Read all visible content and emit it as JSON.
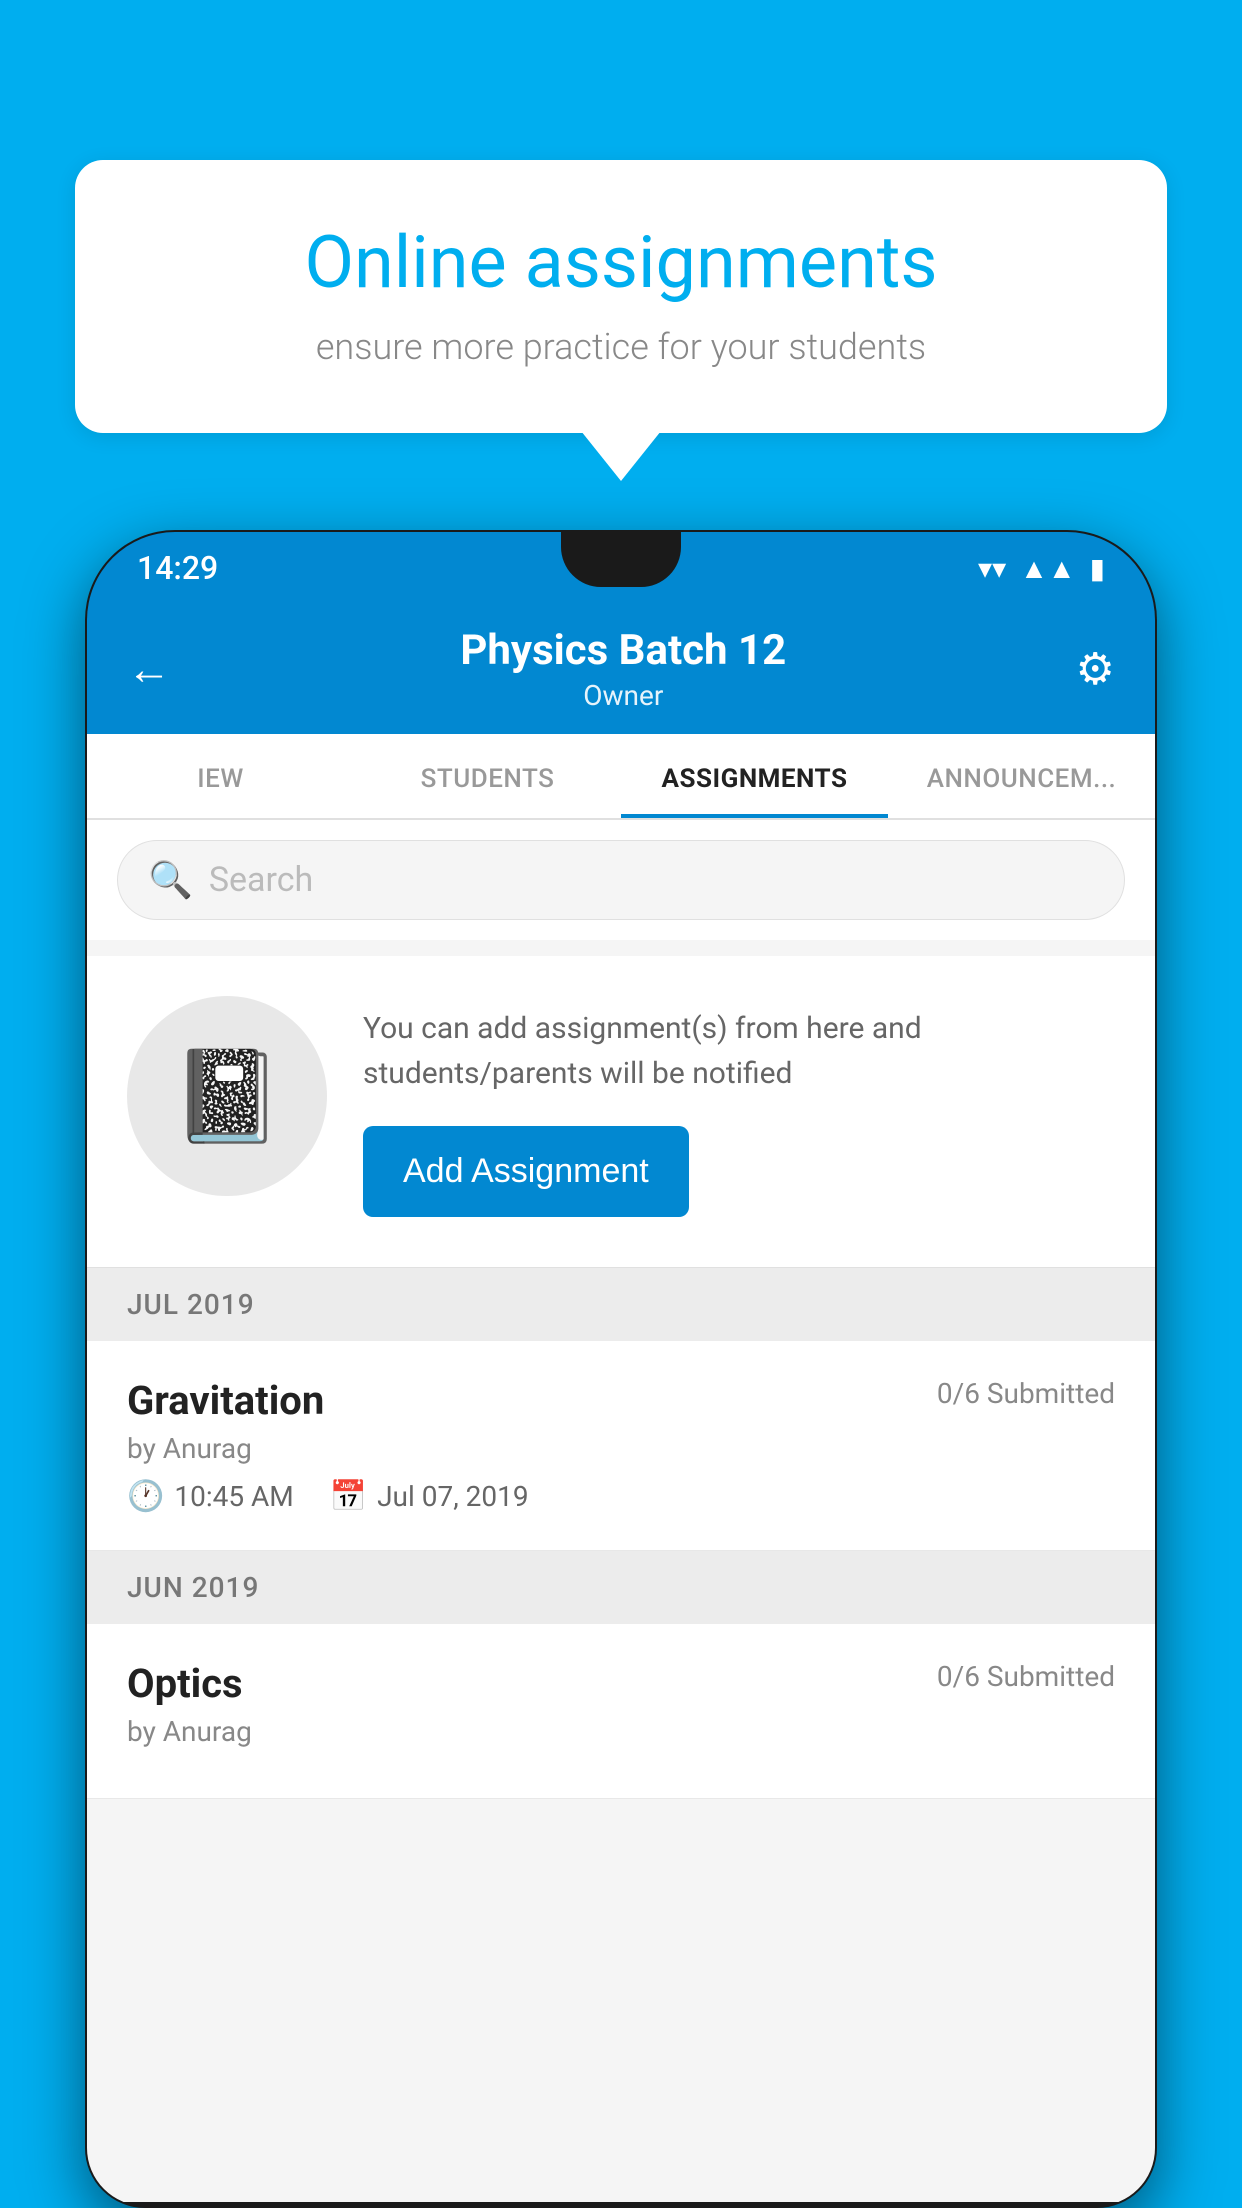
{
  "background_color": "#00AEEF",
  "bubble": {
    "title": "Online assignments",
    "subtitle": "ensure more practice for your students"
  },
  "status_bar": {
    "time": "14:29",
    "wifi_icon": "▼",
    "signal_icon": "◀",
    "battery_icon": "▮"
  },
  "header": {
    "title": "Physics Batch 12",
    "subtitle": "Owner",
    "back_icon": "←",
    "settings_icon": "⚙"
  },
  "tabs": [
    {
      "label": "IEW",
      "active": false
    },
    {
      "label": "STUDENTS",
      "active": false
    },
    {
      "label": "ASSIGNMENTS",
      "active": true
    },
    {
      "label": "ANNOUNCEM...",
      "active": false
    }
  ],
  "search": {
    "placeholder": "Search"
  },
  "promo": {
    "description": "You can add assignment(s) from here and students/parents will be notified",
    "button_label": "Add Assignment"
  },
  "sections": [
    {
      "month": "JUL 2019",
      "assignments": [
        {
          "title": "Gravitation",
          "submitted": "0/6 Submitted",
          "author": "by Anurag",
          "time": "10:45 AM",
          "date": "Jul 07, 2019"
        }
      ]
    },
    {
      "month": "JUN 2019",
      "assignments": [
        {
          "title": "Optics",
          "submitted": "0/6 Submitted",
          "author": "by Anurag",
          "time": "",
          "date": ""
        }
      ]
    }
  ]
}
